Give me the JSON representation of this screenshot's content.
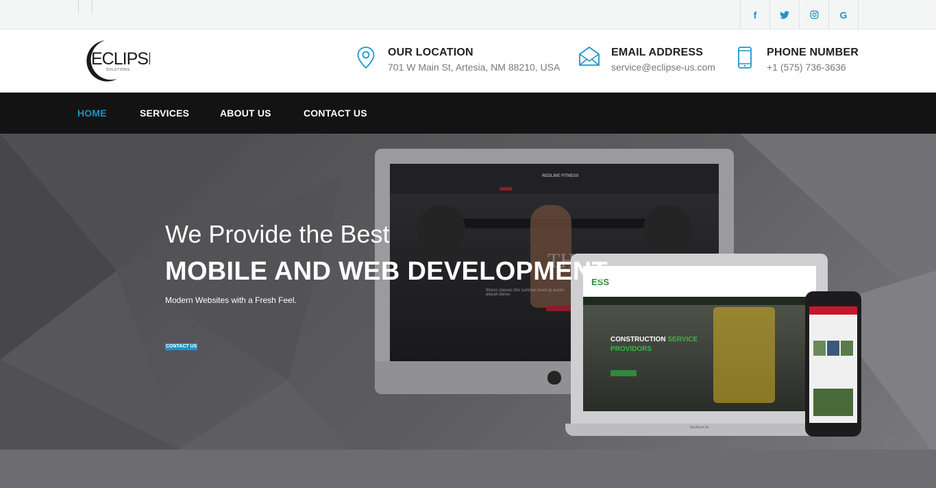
{
  "social": {
    "icons": [
      "facebook-icon",
      "twitter-icon",
      "instagram-icon",
      "google-icon"
    ],
    "glyphs": [
      "f",
      "t",
      "◎",
      "G"
    ]
  },
  "logo": {
    "name": "ECLIPSE",
    "tagline": "SOLUTIONS"
  },
  "contact": {
    "location": {
      "title": "OUR LOCATION",
      "value": "701 W Main St, Artesia, NM 88210, USA"
    },
    "email": {
      "title": "EMAIL ADDRESS",
      "value": "service@eclipse-us.com"
    },
    "phone": {
      "title": "PHONE NUMBER",
      "value": "+1 (575) 736-3636"
    }
  },
  "nav": {
    "home": "HOME",
    "services": "SERVICES",
    "about": "ABOUT US",
    "contact": "CONTACT US"
  },
  "hero": {
    "line1": "We Provide the Best",
    "line2": "MOBILE AND WEB DEVELOPMENT",
    "line3": "Modern Websites with a Fresh Feel.",
    "button": "CONTACT US"
  },
  "mockups": {
    "imac_site": "REDLINE FITNESS",
    "imac_overlay": "THE WO",
    "imac_text": "fitness classes this summer lorem ip auctor aliquet donec",
    "laptop_brand": "ESS",
    "laptop_title_1": "CONSTRUCTION",
    "laptop_title_2": "SERVICE",
    "laptop_title_3": "PROVIDORS",
    "laptop_model": "MacBook Air"
  },
  "colors": {
    "accent": "#1b95c9",
    "nav_bg": "#131313",
    "topbar_bg": "#f4f5f5"
  }
}
